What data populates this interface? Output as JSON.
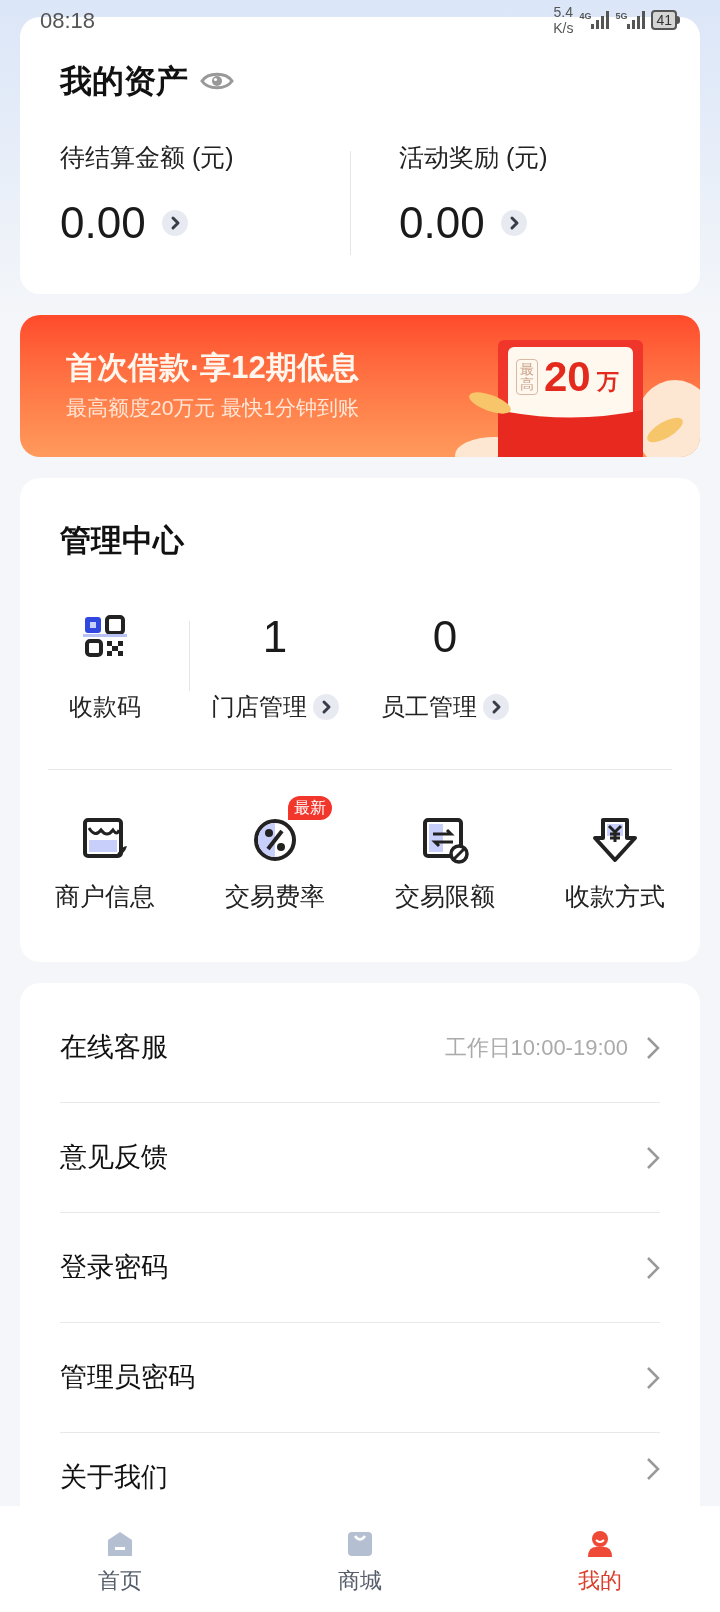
{
  "status_bar": {
    "time": "08:18",
    "speed_value": "5.4",
    "speed_unit": "K/s",
    "network_1": "4G",
    "network_2": "5G",
    "battery": "41"
  },
  "assets": {
    "title": "我的资产",
    "items": [
      {
        "label": "待结算金额 (元)",
        "amount": "0.00"
      },
      {
        "label": "活动奖励 (元)",
        "amount": "0.00"
      }
    ]
  },
  "banner": {
    "title": "首次借款·享12期低息",
    "subtitle": "最高额度20万元 最快1分钟到账",
    "tag": "最高",
    "amount": "20",
    "unit": "万"
  },
  "management": {
    "title": "管理中心",
    "stats": [
      {
        "kind": "icon",
        "label": "收款码"
      },
      {
        "kind": "count",
        "value": "1",
        "label": "门店管理"
      },
      {
        "kind": "count",
        "value": "0",
        "label": "员工管理"
      }
    ],
    "tools": [
      {
        "kind": "store",
        "label": "商户信息"
      },
      {
        "kind": "rate",
        "label": "交易费率",
        "badge": "最新"
      },
      {
        "kind": "limit",
        "label": "交易限额"
      },
      {
        "kind": "payment",
        "label": "收款方式"
      }
    ]
  },
  "menu": [
    {
      "label": "在线客服",
      "detail": "工作日10:00-19:00"
    },
    {
      "label": "意见反馈"
    },
    {
      "label": "登录密码"
    },
    {
      "label": "管理员密码"
    },
    {
      "label": "关于我们"
    }
  ],
  "tab_bar": [
    {
      "kind": "home",
      "label": "首页",
      "selected": false
    },
    {
      "kind": "shop",
      "label": "商城",
      "selected": false
    },
    {
      "kind": "me",
      "label": "我的",
      "selected": true
    }
  ]
}
